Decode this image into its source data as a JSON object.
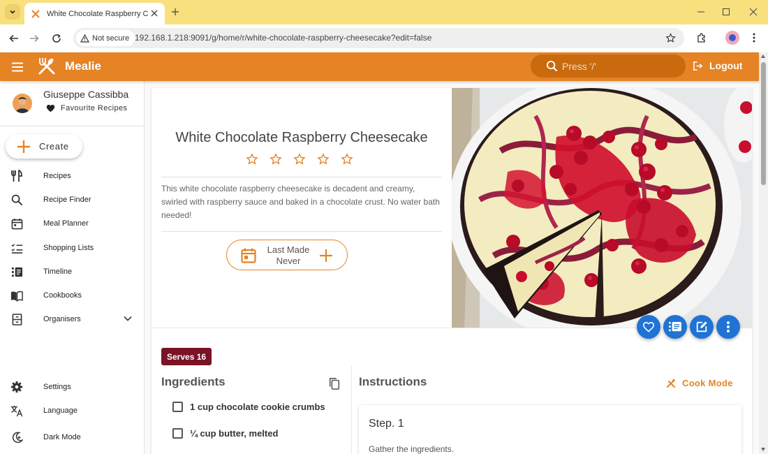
{
  "browser": {
    "tab_title": "White Chocolate Raspberry Cheesecake",
    "security_label": "Not secure",
    "url": "192.168.1.218:9091/g/home/r/white-chocolate-raspberry-cheesecake?edit=false"
  },
  "header": {
    "brand": "Mealie",
    "search_placeholder": "Press '/'",
    "logout_label": "Logout",
    "accent_color": "#e58325"
  },
  "sidebar": {
    "user_name": "Giuseppe Cassibba",
    "favourites_label": "Favourite Recipes",
    "create_label": "Create",
    "nav": [
      {
        "label": "Recipes",
        "icon": "fork-knife-icon"
      },
      {
        "label": "Recipe Finder",
        "icon": "search-icon"
      },
      {
        "label": "Meal Planner",
        "icon": "calendar-icon"
      },
      {
        "label": "Shopping Lists",
        "icon": "checklist-icon"
      },
      {
        "label": "Timeline",
        "icon": "timeline-icon"
      },
      {
        "label": "Cookbooks",
        "icon": "book-icon"
      },
      {
        "label": "Organisers",
        "icon": "cabinet-icon"
      }
    ],
    "footer": [
      {
        "label": "Settings",
        "icon": "gear-icon"
      },
      {
        "label": "Language",
        "icon": "translate-icon"
      },
      {
        "label": "Dark Mode",
        "icon": "moon-icon"
      }
    ]
  },
  "recipe": {
    "title": "White Chocolate Raspberry Cheesecake",
    "rating": 0,
    "rating_max": 5,
    "description": "This white chocolate raspberry cheesecake is decadent and creamy, swirled with raspberry sauce and baked in a chocolate crust. No water bath needed!",
    "last_made_label": "Last Made",
    "last_made_value": "Never",
    "serves": "Serves 16",
    "ingredients_title": "Ingredients",
    "ingredients": [
      "1 cup chocolate cookie crumbs",
      "¼ cup butter, melted"
    ],
    "instructions_title": "Instructions",
    "cook_mode_label": "Cook Mode",
    "steps": [
      {
        "title": "Step. 1",
        "text": "Gather the ingredients."
      }
    ],
    "action_color": "#1f73d4",
    "serves_color": "#7a1325"
  }
}
